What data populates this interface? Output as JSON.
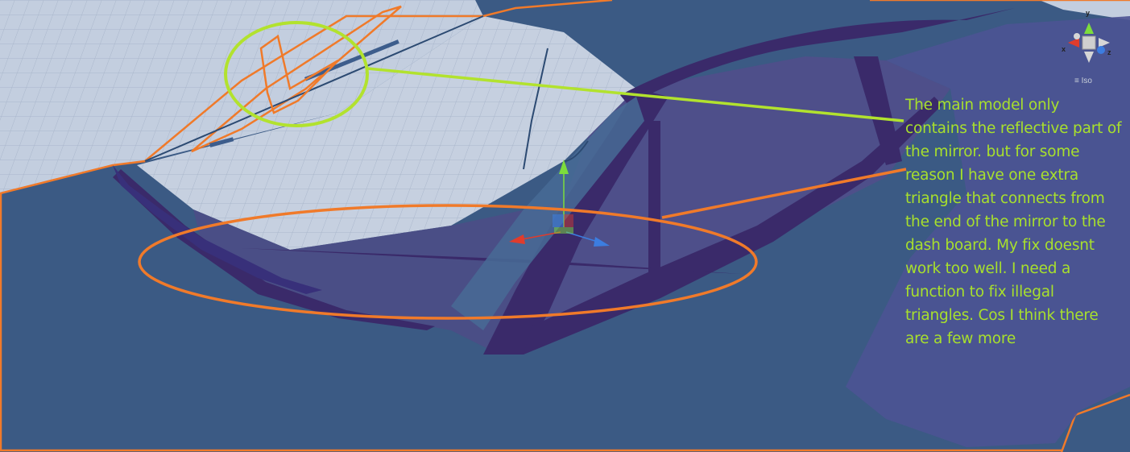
{
  "annotation": {
    "text": "The main model only contains the reflective part of the mirror. but for some reason I have one extra triangle that connects from the end of the mirror to the dash board. My fix doesnt work too well. I need a function to fix illegal triangles. Cos I think there are a few more"
  },
  "scene_gizmo": {
    "projection_label": "Iso",
    "axes": {
      "x": "x",
      "y": "y",
      "z": "z"
    }
  },
  "colors": {
    "background": "#3b5a84",
    "mesh_fill": "#4f4f8a",
    "mesh_edge": "#3a2a6a",
    "grid_floor": "#c4cfe0",
    "selection_outline": "#f07a2a",
    "annotation_text": "#a8e02c",
    "green_circle": "#b2e22e",
    "move_y": "#7ddc3c",
    "move_x": "#e03c2c",
    "move_z": "#3c7de0"
  }
}
